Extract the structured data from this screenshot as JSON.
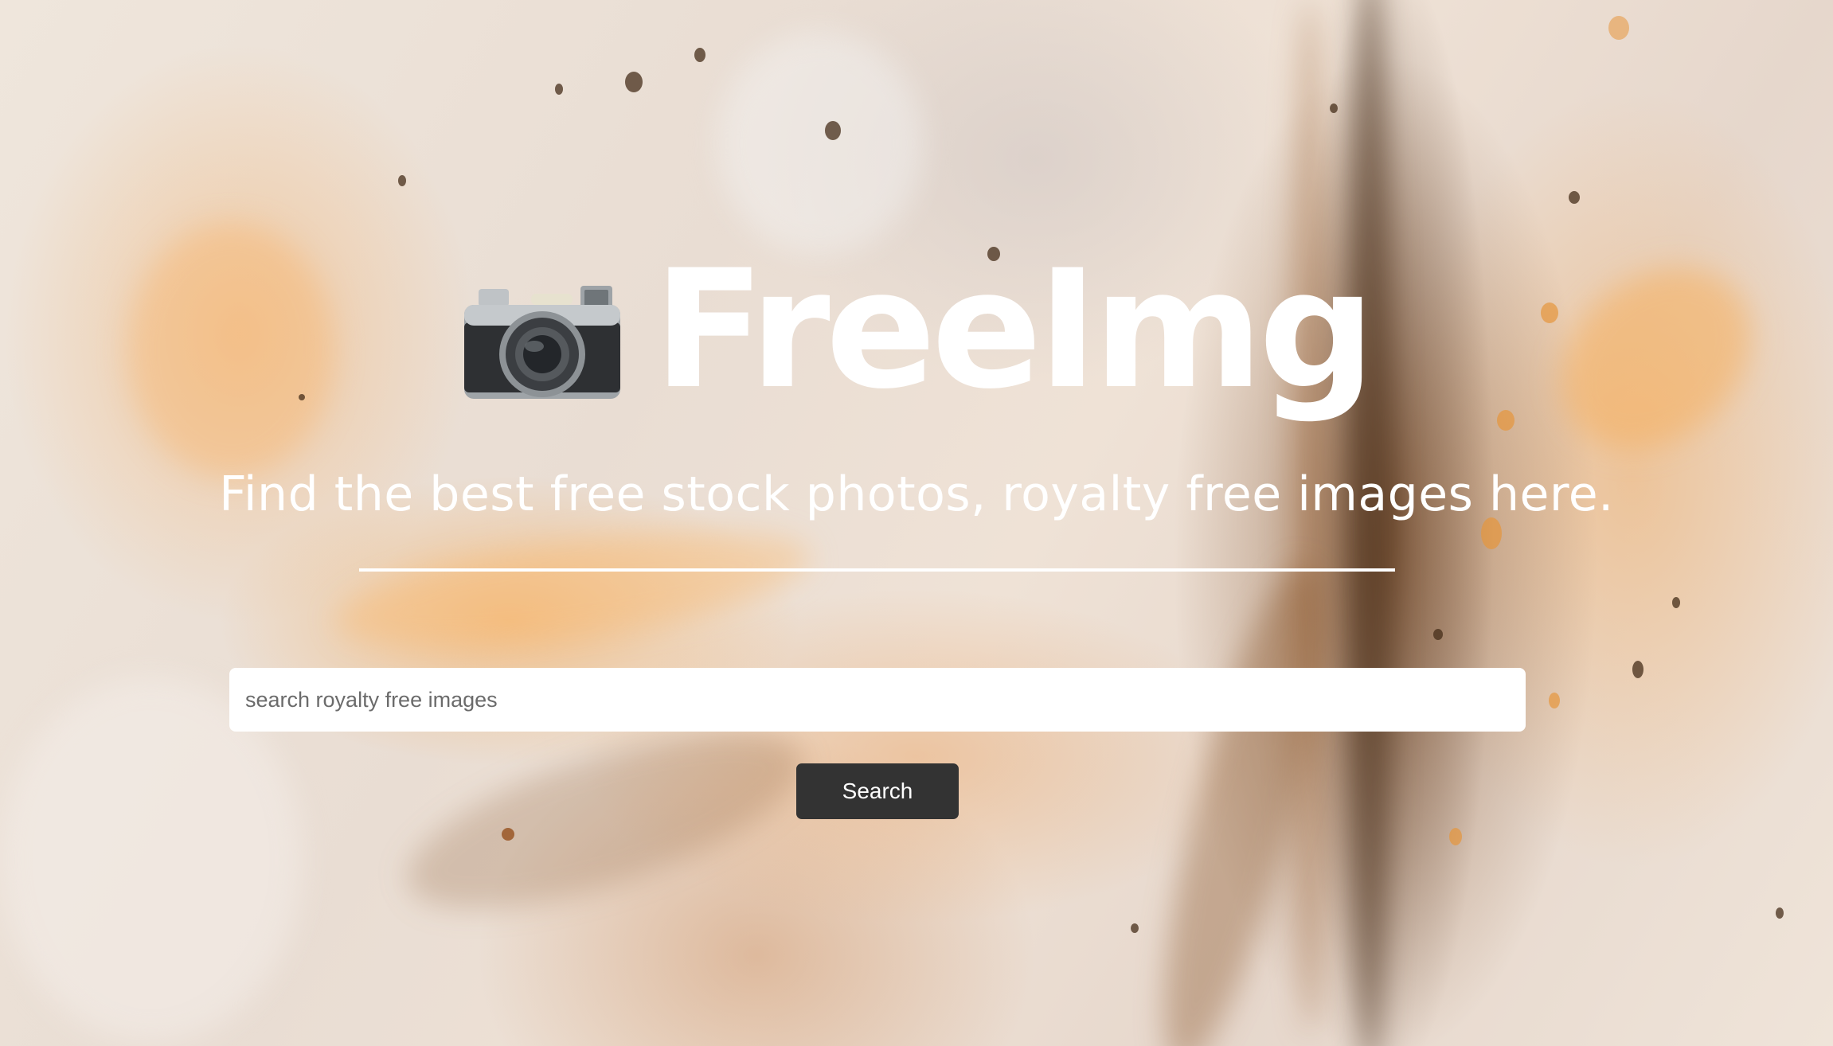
{
  "brand": {
    "logo_icon": "camera-icon",
    "name": "FreeImg"
  },
  "hero": {
    "tagline": "Find the best free stock photos, royalty free images here."
  },
  "search": {
    "placeholder": "search royalty free images",
    "value": "",
    "button_label": "Search"
  },
  "colors": {
    "text": "#ffffff",
    "button_bg": "#333333",
    "input_bg": "#ffffff"
  }
}
